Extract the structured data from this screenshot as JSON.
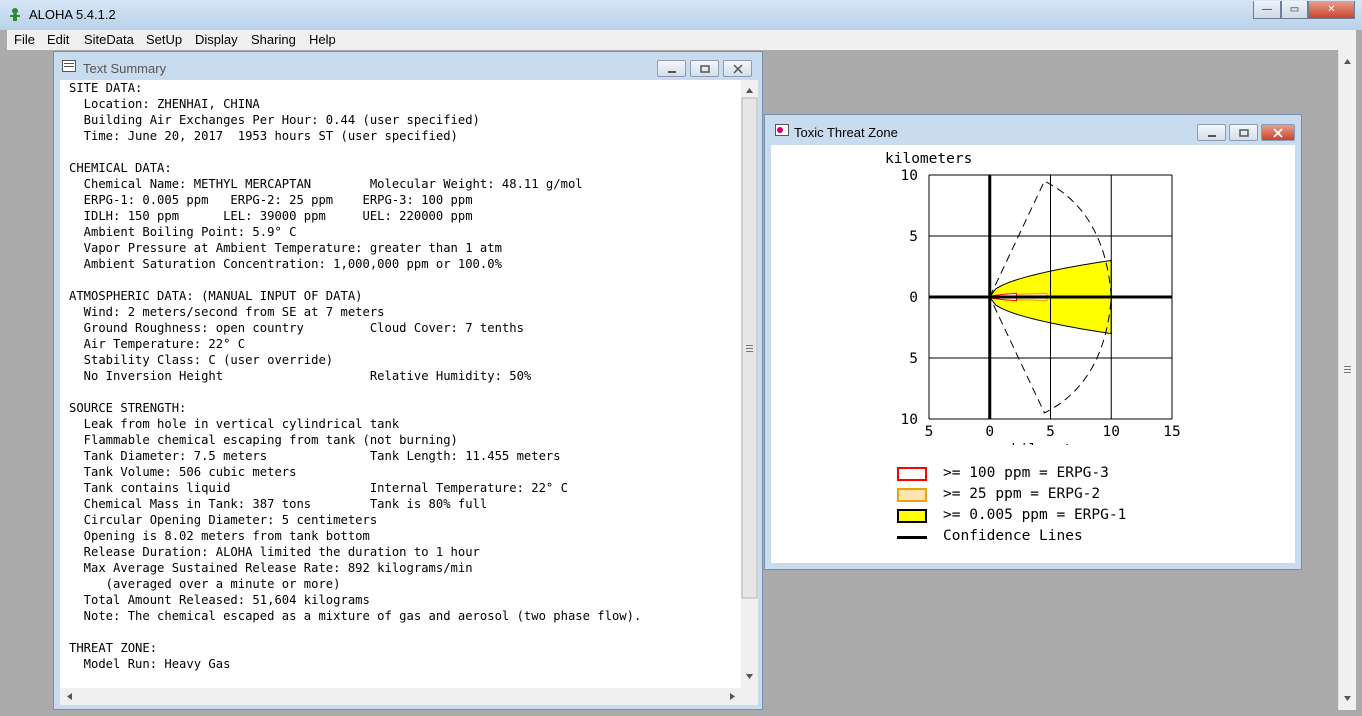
{
  "app": {
    "title": "ALOHA 5.4.1.2",
    "caption_buttons": [
      "—",
      "▭",
      "✕"
    ]
  },
  "menu": {
    "items": [
      "File",
      "Edit",
      "SiteData",
      "SetUp",
      "Display",
      "Sharing",
      "Help"
    ]
  },
  "text_summary": {
    "title": "Text Summary",
    "lines": [
      "SITE DATA:",
      "  Location: ZHENHAI, CHINA",
      "  Building Air Exchanges Per Hour: 0.44 (user specified)",
      "  Time: June 20, 2017  1953 hours ST (user specified)",
      "",
      "CHEMICAL DATA:",
      "  Chemical Name: METHYL MERCAPTAN        Molecular Weight: 48.11 g/mol",
      "  ERPG-1: 0.005 ppm   ERPG-2: 25 ppm    ERPG-3: 100 ppm",
      "  IDLH: 150 ppm      LEL: 39000 ppm     UEL: 220000 ppm",
      "  Ambient Boiling Point: 5.9° C",
      "  Vapor Pressure at Ambient Temperature: greater than 1 atm",
      "  Ambient Saturation Concentration: 1,000,000 ppm or 100.0%",
      "",
      "ATMOSPHERIC DATA: (MANUAL INPUT OF DATA)",
      "  Wind: 2 meters/second from SE at 7 meters",
      "  Ground Roughness: open country         Cloud Cover: 7 tenths",
      "  Air Temperature: 22° C",
      "  Stability Class: C (user override)",
      "  No Inversion Height                    Relative Humidity: 50%",
      "",
      "SOURCE STRENGTH:",
      "  Leak from hole in vertical cylindrical tank",
      "  Flammable chemical escaping from tank (not burning)",
      "  Tank Diameter: 7.5 meters              Tank Length: 11.455 meters",
      "  Tank Volume: 506 cubic meters",
      "  Tank contains liquid                   Internal Temperature: 22° C",
      "  Chemical Mass in Tank: 387 tons        Tank is 80% full",
      "  Circular Opening Diameter: 5 centimeters",
      "  Opening is 8.02 meters from tank bottom",
      "  Release Duration: ALOHA limited the duration to 1 hour",
      "  Max Average Sustained Release Rate: 892 kilograms/min",
      "     (averaged over a minute or more)",
      "  Total Amount Released: 51,604 kilograms",
      "  Note: The chemical escaped as a mixture of gas and aerosol (two phase flow).",
      "",
      "THREAT ZONE:",
      "  Model Run: Heavy Gas"
    ]
  },
  "threat_zone": {
    "title": "Toxic Threat Zone",
    "y_unit_label": "kilometers",
    "x_unit_label": "kilometers",
    "y_ticks": [
      "10",
      "5",
      "0",
      "5",
      "10"
    ],
    "x_ticks": [
      "5",
      "0",
      "5",
      "10",
      "15"
    ],
    "legend": [
      {
        "label": ">= 100 ppm = ERPG-3",
        "color": "#ff0000",
        "fill": "#ffffff"
      },
      {
        "label": ">= 25 ppm = ERPG-2",
        "color": "#f0a000",
        "fill": "#ffe6b0"
      },
      {
        "label": ">= 0.005 ppm = ERPG-1",
        "color": "#000000",
        "fill": "#ffff00"
      },
      {
        "label": "Confidence Lines",
        "color": "#000000",
        "fill": ""
      }
    ]
  },
  "chart_data": {
    "type": "area",
    "title": "Toxic Threat Zone",
    "xlabel": "kilometers",
    "ylabel": "kilometers",
    "xlim": [
      -5,
      15
    ],
    "ylim": [
      -10,
      10
    ],
    "grid": true,
    "legend_placement": "bottom",
    "series": [
      {
        "name": ">= 0.005 ppm = ERPG-1",
        "color": "#ffff00",
        "max_x": 10.0,
        "half_width_at_max": 3.0
      },
      {
        "name": ">= 25 ppm = ERPG-2",
        "color": "#f0a000",
        "max_x": 4.7,
        "half_width_at_max": 0.3
      },
      {
        "name": ">= 100 ppm = ERPG-3",
        "color": "#ff0000",
        "max_x": 2.2,
        "half_width_at_max": 0.3
      },
      {
        "name": "Confidence Lines",
        "color": "#000000",
        "max_x": 10.0,
        "half_width_at_max": 9.5
      }
    ]
  }
}
